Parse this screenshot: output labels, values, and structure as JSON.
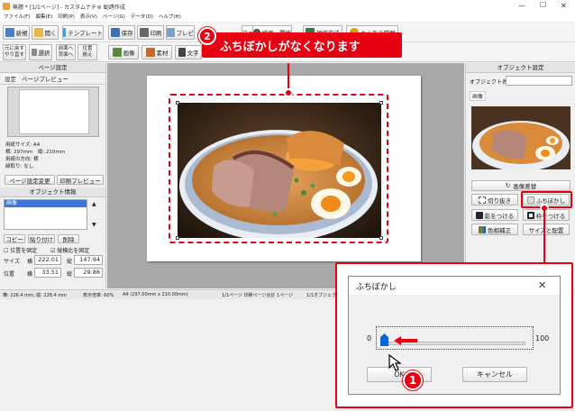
{
  "window": {
    "title": "無題 * [1/1ページ] - カスタムナチゅ 勧誘作成",
    "min": "—",
    "max": "☐",
    "close": "✕"
  },
  "menu": [
    "ファイル(F)",
    "編集(E)",
    "印刷(P)",
    "表示(V)",
    "ページ(G)",
    "データ(D)",
    "ヘルプ(H)"
  ],
  "toolbar": {
    "row1": [
      {
        "label": "新規",
        "icon": "new-file-icon",
        "color": "#4a7fc1"
      },
      {
        "label": "開く",
        "icon": "open-folder-icon",
        "color": "#e8b84a"
      },
      {
        "label": "テンプレート",
        "icon": "template-icon",
        "color": "#4a9ad4"
      },
      {
        "label": "保存",
        "icon": "save-icon",
        "color": "#3d6fb5"
      },
      {
        "label": "印刷",
        "icon": "print-icon",
        "color": "#666666"
      },
      {
        "label": "プレビ",
        "icon": "preview-icon",
        "color": "#7a9fc9"
      }
    ],
    "row1_right": [
      {
        "label": "ファイル出力",
        "icon": "export-icon"
      },
      {
        "label": "検索・置換",
        "icon": "search-icon"
      },
      {
        "label": "操作方法",
        "icon": "help-book-icon"
      },
      {
        "label": "よくある質問",
        "icon": "faq-icon"
      }
    ],
    "row2": [
      {
        "label": "元に戻す"
      },
      {
        "label": "やり直す"
      },
      {
        "label": "選択"
      },
      {
        "label": "前面へ"
      },
      {
        "label": "背面へ"
      },
      {
        "label": "位置"
      },
      {
        "label": "揃え"
      }
    ],
    "insert": [
      {
        "label": "画像",
        "icon": "image-icon"
      },
      {
        "label": "素材",
        "icon": "clip-art-icon"
      },
      {
        "label": "文字",
        "icon": "text-icon"
      }
    ]
  },
  "callout": {
    "step2_number": "2",
    "step2_text": "ふちぼかしがなくなります",
    "step1_number": "1",
    "accent": "#e60012"
  },
  "left_panel": {
    "page_settings_title": "ページ設定",
    "tabs": [
      "設定",
      "ページプレビュー"
    ],
    "info_lines": [
      "用紙サイズ: A4",
      "横: 297mm　縦: 210mm",
      "用紙の方向: 横",
      "縁取り: なし"
    ],
    "page_settings_button": "ページ設定変更",
    "print_preview_button": "印刷プレビュー",
    "object_info_title": "オブジェクト情報",
    "object_list": [
      "画像"
    ],
    "copy_button": "コピー",
    "paste_button": "貼り付け",
    "delete_button": "削除",
    "lock_position": "位置を固定",
    "lock_aspect": "縦横比を固定",
    "size_label": "サイズ",
    "pos_label": "位置",
    "width_label": "横",
    "height_label": "縦",
    "size_w": "222.01",
    "size_h": "147.94",
    "pos_x": "33.51",
    "pos_y": "29.86"
  },
  "right_panel": {
    "title": "オブジェクト設定",
    "name_label": "オブジェクト名",
    "name_value": "",
    "tab": "画像",
    "replace_button": "画像差替",
    "crop_button": "切り抜き",
    "blur_button": "ふちぼかし",
    "shadow_button": "影をつける",
    "frame_button": "枠をつける",
    "color_button": "色相補正",
    "size_pos_button": "サイズと配置"
  },
  "status": {
    "size": "横: 226.4 mm, 縦: 228.4 mm",
    "zoom": "表示倍率: 60%",
    "paper": "A4 (297.00mm x 210.00mm)",
    "page": "1/1ページ 印刷ページ合計 1ページ",
    "object": "1/1オブジェクト"
  },
  "dialog": {
    "title": "ふちぼかし",
    "close": "✕",
    "min": "0",
    "max": "100",
    "value": 0,
    "ok_label": "OK",
    "cancel_label": "キャンセル"
  }
}
